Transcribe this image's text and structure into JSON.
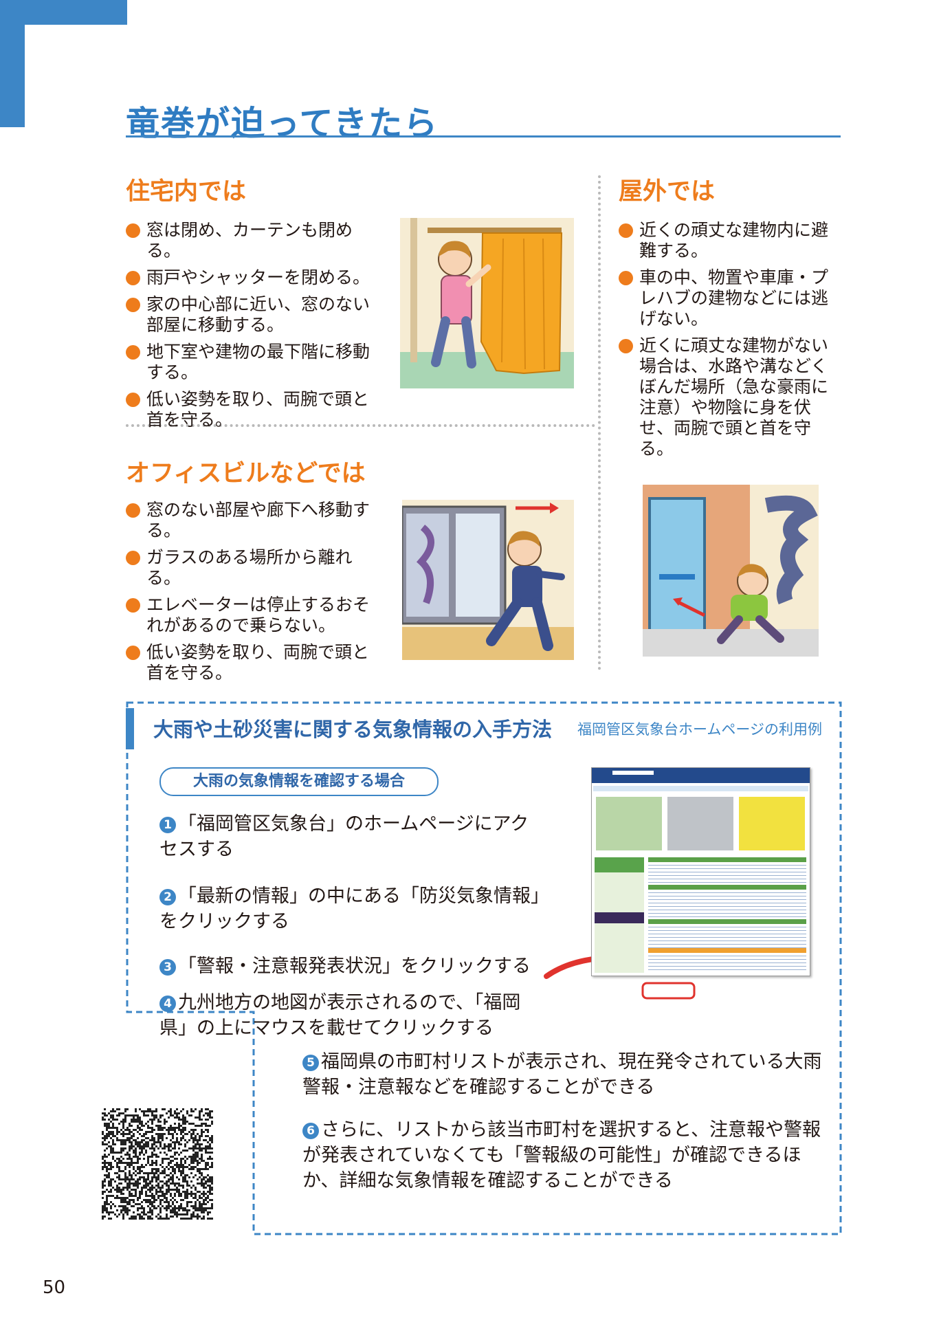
{
  "page": {
    "title": "竜巻が迫ってきたら",
    "page_number": "50"
  },
  "home": {
    "heading": "住宅内では",
    "items": [
      "窓は閉め、カーテンも閉める。",
      "雨戸やシャッターを閉める。",
      "家の中心部に近い、窓のない部屋に移動する。",
      "地下室や建物の最下階に移動する。",
      "低い姿勢を取り、両腕で頭と首を守る。"
    ]
  },
  "outdoor": {
    "heading": "屋外では",
    "items": [
      "近くの頑丈な建物内に避難する。",
      "車の中、物置や車庫・プレハブの建物などには逃げない。",
      "近くに頑丈な建物がない場合は、水路や溝などくぼんだ場所（急な豪雨に注意）や物陰に身を伏せ、両腕で頭と首を守る。"
    ]
  },
  "office": {
    "heading": "オフィスビルなどでは",
    "items": [
      "窓のない部屋や廊下へ移動する。",
      "ガラスのある場所から離れる。",
      "エレベーターは停止するおそれがあるので乗らない。",
      "低い姿勢を取り、両腕で頭と首を守る。"
    ]
  },
  "info": {
    "title": "大雨や土砂災害に関する気象情報の入手方法",
    "subtitle": "福岡管区気象台ホームページの利用例",
    "pill": "大雨の気象情報を確認する場合",
    "steps": [
      {
        "num": "1",
        "text": "「福岡管区気象台」のホームページにアクセスする"
      },
      {
        "num": "2",
        "text": "「最新の情報」の中にある「防災気象情報」をクリックする"
      },
      {
        "num": "3",
        "text": "「警報・注意報発表状況」をクリックする"
      },
      {
        "num": "4",
        "text": "九州地方の地図が表示されるので、「福岡県」の上にマウスを載せてクリックする"
      },
      {
        "num": "5",
        "text": "福岡県の市町村リストが表示され、現在発令されている大雨警報・注意報などを確認することができる"
      },
      {
        "num": "6",
        "text": "さらに、リストから該当市町村を選択すると、注意報や警報が発表されていなくても「警報級の可能性」が確認できるほか、詳細な気象情報を確認することができる"
      }
    ]
  },
  "colors": {
    "title_blue": "#2f7cc2",
    "heading_orange": "#ee7c1c",
    "info_blue": "#3d86c6"
  },
  "icons": [
    "bullet-dot",
    "step-number-badge",
    "red-arrow",
    "qr-code"
  ]
}
